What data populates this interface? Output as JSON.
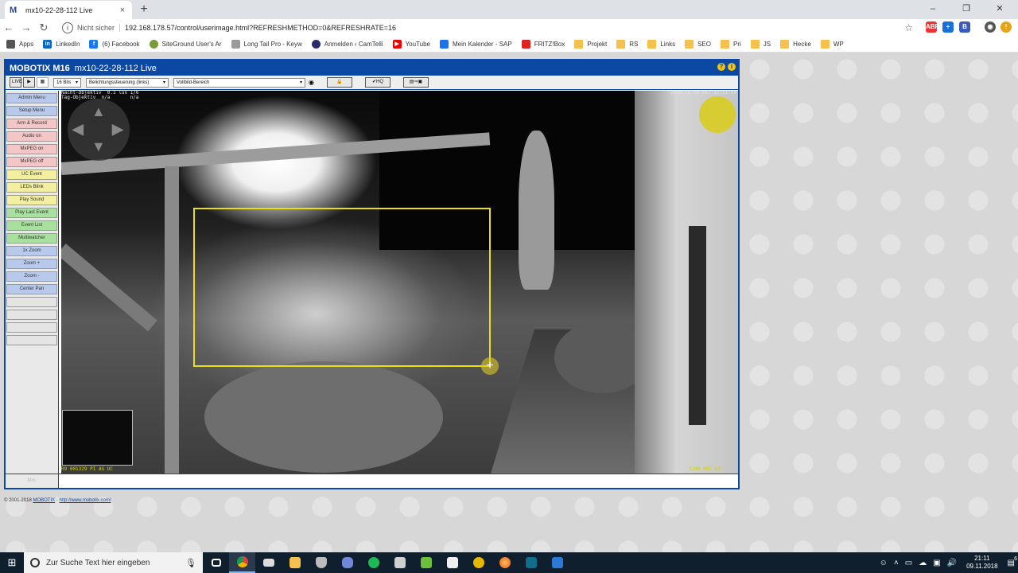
{
  "browser": {
    "tab_title": "mx10-22-28-112 Live",
    "tab_close": "×",
    "new_tab": "+",
    "win_minimize": "–",
    "win_restore": "❐",
    "win_close": "✕",
    "nav_back": "←",
    "nav_forward": "→",
    "nav_reload": "↻",
    "security": "Nicht sicher",
    "url": "192.168.178.57/control/userimage.html?REFRESHMETHOD=0&REFRESHRATE=16",
    "star": "☆",
    "extensions": [
      "ABP",
      "+",
      "B",
      "◉"
    ],
    "bookmarks": [
      {
        "label": "Apps",
        "icon": "apps-icon"
      },
      {
        "label": "LinkedIn",
        "icon": "linkedin-icon"
      },
      {
        "label": "(6) Facebook",
        "icon": "facebook-icon"
      },
      {
        "label": "SiteGround User's Ar",
        "icon": "siteground-icon"
      },
      {
        "label": "Long Tail Pro - Keyw",
        "icon": "longtail-icon"
      },
      {
        "label": "Anmelden ‹ CamTelli",
        "icon": "camtelli-icon"
      },
      {
        "label": "YouTube",
        "icon": "youtube-icon"
      },
      {
        "label": "Mein Kalender - SAP",
        "icon": "calendar-icon"
      },
      {
        "label": "FRITZ!Box",
        "icon": "fritzbox-icon"
      },
      {
        "label": "Projekt",
        "icon": "folder-icon"
      },
      {
        "label": "RS",
        "icon": "folder-icon"
      },
      {
        "label": "Links",
        "icon": "folder-icon"
      },
      {
        "label": "SEO",
        "icon": "folder-icon"
      },
      {
        "label": "Pri",
        "icon": "folder-icon"
      },
      {
        "label": "JS",
        "icon": "folder-icon"
      },
      {
        "label": "Hecke",
        "icon": "folder-icon"
      },
      {
        "label": "WP",
        "icon": "folder-icon"
      }
    ]
  },
  "mobotix": {
    "brand": "MOBOTIX M16",
    "camera_name": "mx10-22-28-112 Live",
    "toolbar": {
      "live_btn": "LIVE",
      "play_btn": "▶",
      "grid_btn": "▦",
      "bits_select": "16 Bits",
      "exposure_select": "Belichtungssteuerung (links)",
      "area_select": "Vollbild-Bereich",
      "lock_btn": "🔒",
      "hq_btn": "✔HQ",
      "save_btn": "▤⇒▣"
    },
    "sidebar_buttons": [
      {
        "label": "Admin Menu",
        "color": "blue"
      },
      {
        "label": "Setup Menu",
        "color": "blue"
      },
      {
        "label": "Arm & Record",
        "color": "red"
      },
      {
        "label": "Audio on",
        "color": "red"
      },
      {
        "label": "MxPEG on",
        "color": "red"
      },
      {
        "label": "MxPEG off",
        "color": "red"
      },
      {
        "label": "UC Event",
        "color": "yellow"
      },
      {
        "label": "LEDs Blink",
        "color": "yellow"
      },
      {
        "label": "Play Sound",
        "color": "yellow"
      },
      {
        "label": "Play Last Event",
        "color": "green"
      },
      {
        "label": "Event List",
        "color": "green"
      },
      {
        "label": "Multiwatcher",
        "color": "green"
      },
      {
        "label": "1x Zoom",
        "color": "blue"
      },
      {
        "label": "Zoom +",
        "color": "blue"
      },
      {
        "label": "Zoom -",
        "color": "blue"
      },
      {
        "label": "Center Pan",
        "color": "blue"
      },
      {
        "label": "",
        "color": "empty"
      },
      {
        "label": "",
        "color": "empty"
      },
      {
        "label": "",
        "color": "empty"
      },
      {
        "label": "",
        "color": "empty"
      }
    ],
    "bottom_cell": "MxL",
    "overlay_top_left": "Nacht-Objektiv  0.1 lux 1/6\nTag-Objektiv  n/a       n/a",
    "overlay_top_right": "2018-11-09 CET 21:11:10",
    "thumb_label": "R9 001329 PI AS UC",
    "status_bottom_right": "F200 REC 01",
    "ptz_arrows": {
      "up": "▲",
      "down": "▼",
      "left": "◀",
      "right": "▶"
    },
    "handle": "+"
  },
  "footer": {
    "copyright": "© 2001-2018",
    "company_link": "MOBOTIX",
    "separator": " · ",
    "url_link": "http://www.mobotix.com/"
  },
  "taskbar": {
    "search_placeholder": "Zur Suche Text hier eingeben",
    "time": "21:11",
    "date": "09.11.2018",
    "notifications_badge": "6",
    "apps": [
      "task-view",
      "chrome",
      "mail",
      "file-explorer",
      "shield",
      "discord",
      "spotify",
      "notepad",
      "app-green",
      "app-white",
      "app-yellow",
      "firefox",
      "app-teal",
      "app-blue"
    ]
  },
  "colors": {
    "mobotix_blue": "#0b48a4",
    "selection_yellow": "#e8e010",
    "taskbar": "#101f2e"
  }
}
